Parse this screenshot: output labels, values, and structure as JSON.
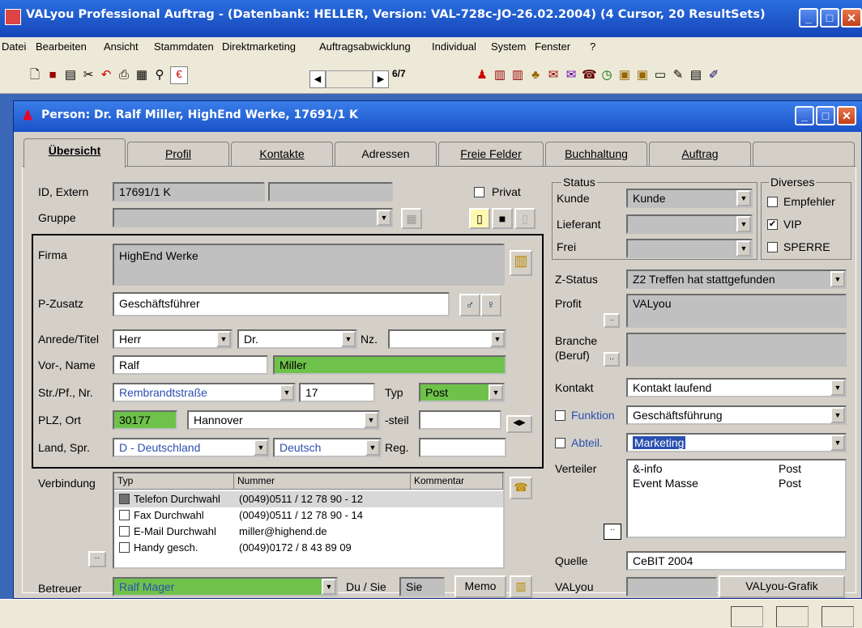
{
  "window": {
    "title": "VALyou Professional Auftrag - (Datenbank: HELLER, Version: VAL-728c-JO-26.02.2004)  (4 Cursor, 20 ResultSets)"
  },
  "menu": [
    "Datei",
    "Bearbeiten",
    "Ansicht",
    "Stammdaten",
    "Direktmarketing",
    "Auftragsabwicklung",
    "Individual",
    "System",
    "Fenster",
    "?"
  ],
  "toolbar": {
    "record_counter": "6/7",
    "euro": "€"
  },
  "child": {
    "title": "Person: Dr. Ralf Miller, HighEnd Werke, 17691/1 K"
  },
  "tabs": [
    "Übersicht",
    "Profil",
    "Kontakte",
    "Adressen",
    "Freie Felder",
    "Buchhaltung",
    "Auftrag"
  ],
  "form": {
    "id_label": "ID, Extern",
    "id_value": "17691/1 K",
    "privat_label": "Privat",
    "gruppe_label": "Gruppe",
    "firma_label": "Firma",
    "firma_value": "HighEnd Werke",
    "pzusatz_label": "P-Zusatz",
    "pzusatz_value": "Geschäftsführer",
    "anrede_label": "Anrede/Titel",
    "anrede_value": "Herr",
    "titel_value": "Dr.",
    "nz_label": "Nz.",
    "name_label": "Vor-, Name",
    "vorname": "Ralf",
    "nachname": "Miller",
    "str_label": "Str./Pf., Nr.",
    "strasse": "Rembrandtstraße",
    "nr": "17",
    "typ_label": "Typ",
    "typ_value": "Post",
    "plz_label": "PLZ, Ort",
    "plz": "30177",
    "ort": "Hannover",
    "steil_label": "-steil",
    "land_label": "Land, Spr.",
    "land": "D - Deutschland",
    "sprache": "Deutsch",
    "reg_label": "Reg.",
    "verbindung_label": "Verbindung",
    "table_headers": [
      "Typ",
      "Nummer",
      "Kommentar"
    ],
    "connections": [
      {
        "typ": "Telefon Durchwahl",
        "nummer": "(0049)0511 / 12 78 90 - 12"
      },
      {
        "typ": "Fax Durchwahl",
        "nummer": "(0049)0511 / 12 78 90 - 14"
      },
      {
        "typ": "E-Mail Durchwahl",
        "nummer": "miller@highend.de"
      },
      {
        "typ": "Handy gesch.",
        "nummer": "(0049)0172 / 8 43 89 09"
      }
    ],
    "betreuer_label": "Betreuer",
    "betreuer_value": "Ralf Mager",
    "dusie_label": "Du / Sie",
    "dusie_value": "Sie",
    "memo_label": "Memo"
  },
  "right": {
    "status_group": "Status",
    "kunde_label": "Kunde",
    "kunde_value": "Kunde",
    "lieferant_label": "Lieferant",
    "frei_label": "Frei",
    "diverses_group": "Diverses",
    "empfehler_label": "Empfehler",
    "vip_label": "VIP",
    "sperre_label": "SPERRE",
    "zstatus_label": "Z-Status",
    "zstatus_value": "Z2 Treffen hat stattgefunden",
    "profit_label": "Profit",
    "profit_value": "VALyou",
    "branche_label": "Branche",
    "beruf_label": "(Beruf)",
    "kontakt_label": "Kontakt",
    "kontakt_value": "Kontakt laufend",
    "funktion_label": "Funktion",
    "funktion_value": "Geschäftsführung",
    "abteil_label": "Abteil.",
    "abteil_value": "Marketing",
    "verteiler_label": "Verteiler",
    "verteiler": [
      {
        "name": "&-info",
        "typ": "Post"
      },
      {
        "name": "Event Masse",
        "typ": "Post"
      }
    ],
    "quelle_label": "Quelle",
    "quelle_value": "CeBIT 2004",
    "valyou_label": "VALyou",
    "valyou_grafik": "VALyou-Grafik"
  },
  "colors": {
    "title_blue": "#1a52c8",
    "green_field": "#6ec24a",
    "mdi": "#3b67b8"
  }
}
